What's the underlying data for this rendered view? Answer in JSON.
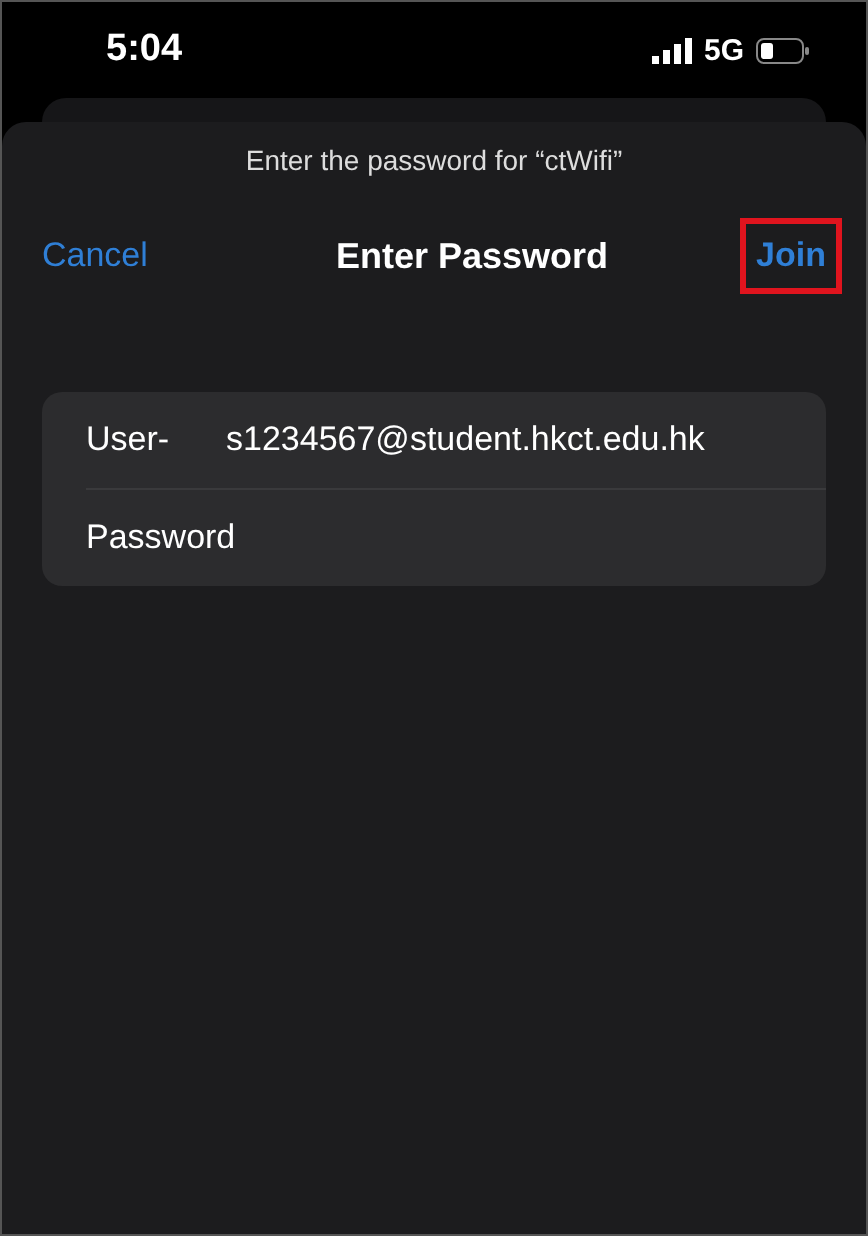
{
  "status_bar": {
    "time": "5:04",
    "network": "5G"
  },
  "sheet": {
    "prompt": "Enter the password for “ctWifi”",
    "title": "Enter Password",
    "cancel": "Cancel",
    "join": {
      "label": "Join",
      "highlighted": true
    }
  },
  "fields": [
    {
      "label": "User-",
      "value": "s1234567@student.hkct.edu.hk"
    },
    {
      "label": "Password"
    }
  ]
}
